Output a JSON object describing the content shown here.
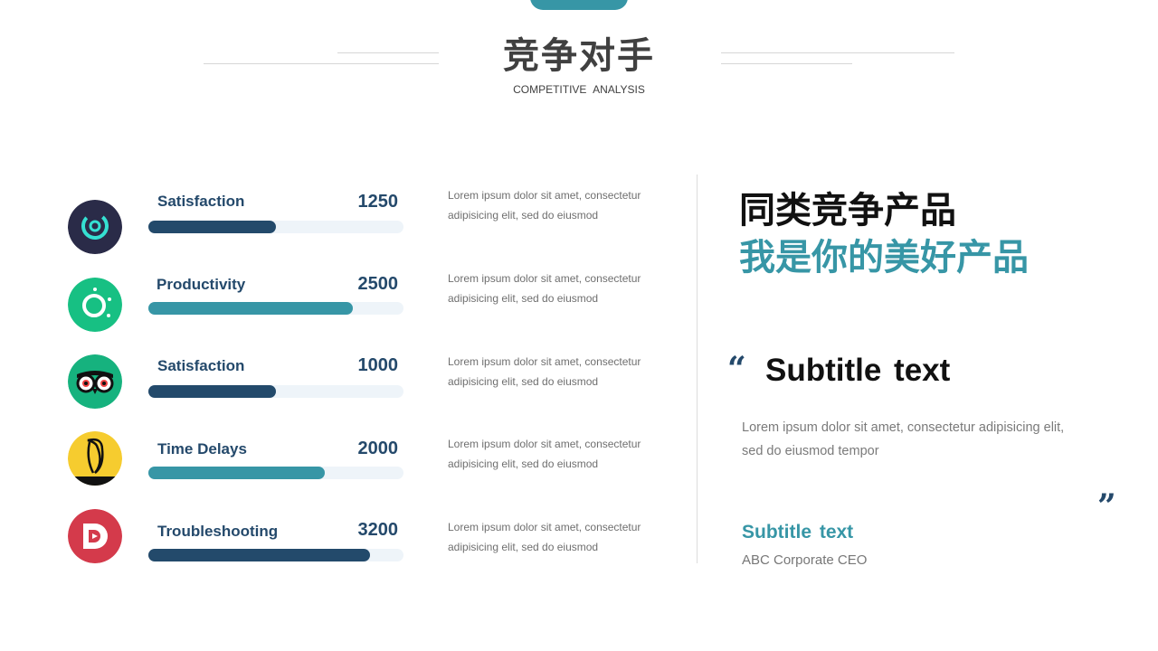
{
  "header": {
    "title": "竞争对手",
    "subtitle": "COMPETITIVE  ANALYSIS"
  },
  "metrics": [
    {
      "label": "Satisfaction",
      "value": "1250",
      "progress": 0.5,
      "bar_color": "#234a6b",
      "desc_line1": "Lorem ipsum dolor sit amet, consectetur",
      "desc_line2": "adipisicing elit, sed do eiusmod",
      "icon": "target-icon"
    },
    {
      "label": "Productivity",
      "value": "2500",
      "progress": 0.8,
      "bar_color": "#3796a6",
      "desc_line1": "Lorem ipsum dolor sit amet, consectetur",
      "desc_line2": "adipisicing elit, sed do eiusmod",
      "icon": "ring-icon"
    },
    {
      "label": "Satisfaction",
      "value": "1000",
      "progress": 0.5,
      "bar_color": "#234a6b",
      "desc_line1": "Lorem ipsum dolor sit amet, consectetur",
      "desc_line2": "adipisicing elit, sed do eiusmod",
      "icon": "owl-icon"
    },
    {
      "label": "Time Delays",
      "value": "2000",
      "progress": 0.69,
      "bar_color": "#3796a6",
      "desc_line1": "Lorem ipsum dolor sit amet, consectetur",
      "desc_line2": "adipisicing elit, sed do eiusmod",
      "icon": "banana-icon"
    },
    {
      "label": "Troubleshooting",
      "value": "3200",
      "progress": 0.87,
      "bar_color": "#234a6b",
      "desc_line1": "Lorem ipsum dolor sit amet, consectetur",
      "desc_line2": "adipisicing elit, sed do eiusmod",
      "icon": "d-logo-icon"
    }
  ],
  "right": {
    "headline_line1": "同类竞争产品",
    "headline_line2": "我是你的美好产品",
    "open_quote": "“",
    "close_quote": "”",
    "subtitle": "Subtitle  text",
    "quote_line1": "Lorem ipsum dolor sit amet, consectetur adipisicing elit,",
    "quote_line2": "sed do eiusmod tempor",
    "author_name": "Subtitle  text",
    "author_role": "ABC Corporate CEO"
  },
  "colors": {
    "accent": "#3796a6",
    "navy": "#234a6b",
    "track": "#eef4f9"
  }
}
